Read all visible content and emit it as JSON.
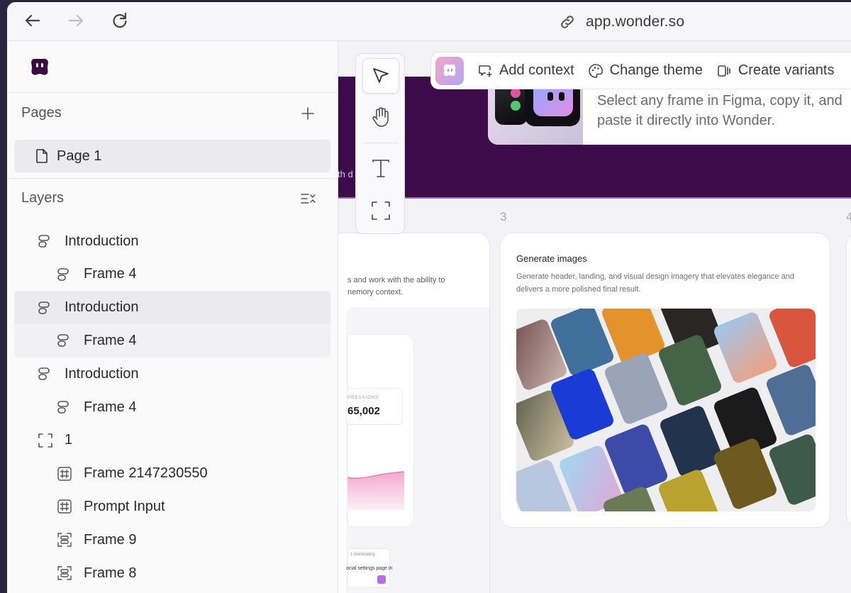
{
  "browser": {
    "url": "app.wonder.so"
  },
  "sidebar": {
    "pages_heading": "Pages",
    "pages": [
      {
        "label": "Page 1"
      }
    ],
    "layers_heading": "Layers",
    "layers": [
      {
        "label": "Introduction",
        "icon": "layout-icon",
        "indent": 0
      },
      {
        "label": "Frame 4",
        "icon": "layout-icon",
        "indent": 1
      },
      {
        "label": "Introduction",
        "icon": "layout-icon",
        "indent": 0,
        "selected": true
      },
      {
        "label": "Frame 4",
        "icon": "layout-icon",
        "indent": 1,
        "selected": true
      },
      {
        "label": "Introduction",
        "icon": "layout-icon",
        "indent": 0
      },
      {
        "label": "Frame 4",
        "icon": "layout-icon",
        "indent": 1
      },
      {
        "label": "1",
        "icon": "frame-icon",
        "indent": 0
      },
      {
        "label": "Frame 2147230550",
        "icon": "hash-frame-icon",
        "indent": 1
      },
      {
        "label": "Prompt Input",
        "icon": "hash-frame-icon",
        "indent": 1
      },
      {
        "label": "Frame 9",
        "icon": "stack-frame-icon",
        "indent": 1
      },
      {
        "label": "Frame 8",
        "icon": "stack-frame-icon",
        "indent": 1
      }
    ]
  },
  "toolbar": {
    "tools": [
      "pointer-icon",
      "hand-icon",
      "text-icon",
      "frame-icon"
    ],
    "context_actions": [
      {
        "label": "Add context",
        "icon": "add-comment-icon"
      },
      {
        "label": "Change theme",
        "icon": "palette-icon"
      },
      {
        "label": "Create variants",
        "icon": "variants-icon"
      }
    ]
  },
  "canvas": {
    "hero_text_line1": "Select any frame in Figma, copy it, and",
    "hero_text_line2": "paste it directly into Wonder.",
    "band_text": "th                    d tricks.",
    "column_numbers": [
      "3",
      "4"
    ],
    "card2": {
      "desc_line1": "s and work with the ability to",
      "desc_line2": "nemory context.",
      "stat_label": "PRESSIONS",
      "stat_value": "65,002",
      "mini_status": "1 Generating",
      "mini_text": "ocial settings page in"
    },
    "card3": {
      "title": "Generate images",
      "desc": "Generate header, landing, and visual design imagery that elevates elegance and delivers a more polished final result."
    }
  },
  "colors": {
    "band": "#3d0a4a",
    "accent": "#b66ce8",
    "logo": "#3a0d3f"
  }
}
